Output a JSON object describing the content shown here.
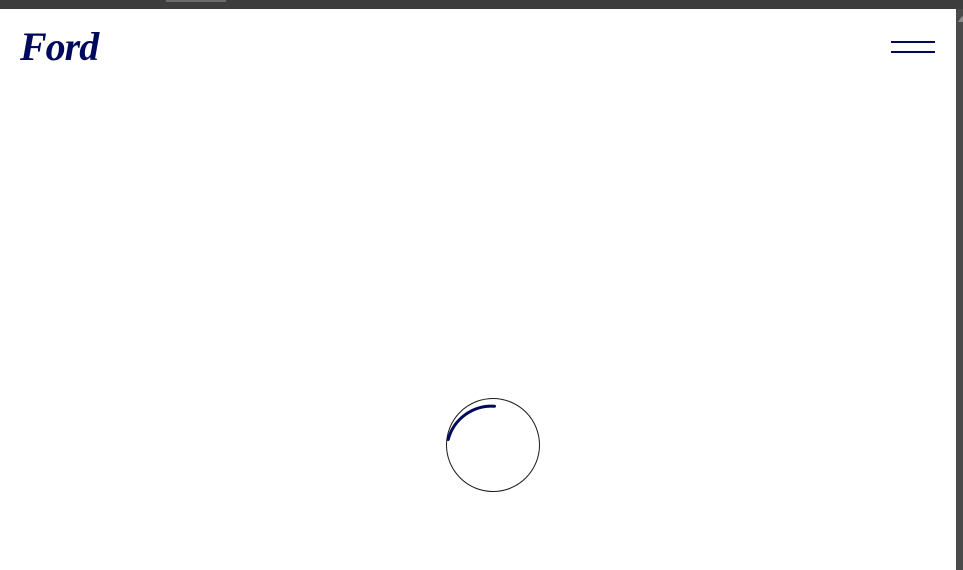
{
  "brand": {
    "logo_text": "Ford",
    "logo_color": "#00095b"
  },
  "header": {
    "menu_icon": "hamburger-menu-icon"
  },
  "loader": {
    "icon": "loading-spinner-icon",
    "accent_color": "#00095b",
    "track_color": "#1a1a1a"
  }
}
